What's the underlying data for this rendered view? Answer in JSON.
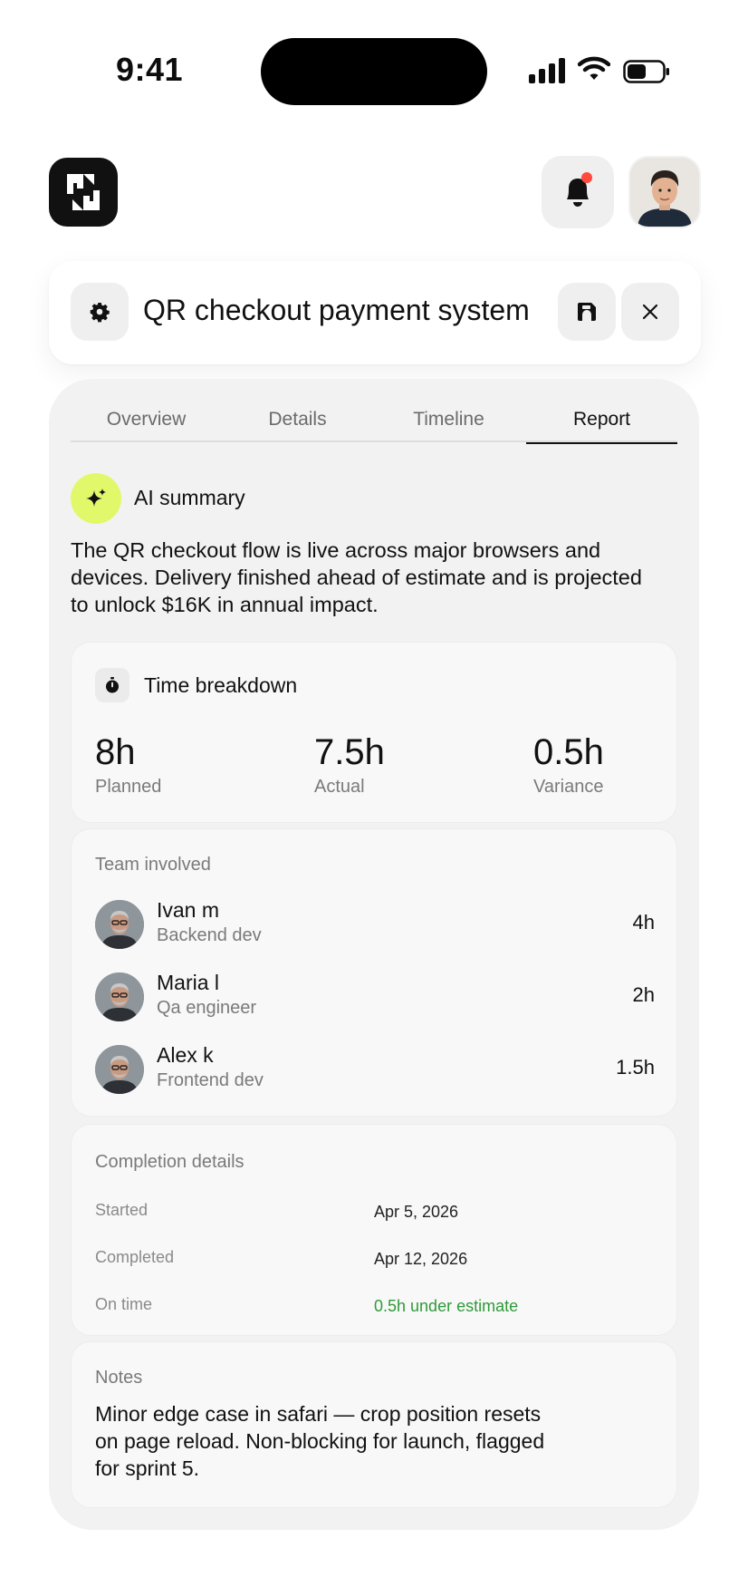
{
  "status_bar": {
    "time": "9:41"
  },
  "header": {
    "logo_icon": "app-logo-icon",
    "notification_dot_color": "#ff4a3d"
  },
  "title_bar": {
    "title": "QR checkout payment system"
  },
  "tabs": [
    {
      "label": "Overview"
    },
    {
      "label": "Details"
    },
    {
      "label": "Timeline"
    },
    {
      "label": "Report",
      "active": true
    }
  ],
  "ai_summary": {
    "label": "AI summary",
    "accent_color": "#e2f86b",
    "text": "The QR checkout flow is live across major browsers and devices. Delivery finished ahead of estimate and is projected to unlock $16K in annual impact."
  },
  "time_breakdown": {
    "label": "Time breakdown",
    "metrics": [
      {
        "value": "8h",
        "label": "Planned"
      },
      {
        "value": "7.5h",
        "label": "Actual"
      },
      {
        "value": "0.5h",
        "label": "Variance"
      }
    ]
  },
  "team": {
    "label": "Team involved",
    "members": [
      {
        "name": "Ivan m",
        "role": "Backend dev",
        "hours": "4h"
      },
      {
        "name": "Maria l",
        "role": "Qa engineer",
        "hours": "2h"
      },
      {
        "name": "Alex k",
        "role": "Frontend dev",
        "hours": "1.5h"
      }
    ]
  },
  "completion": {
    "label": "Completion details",
    "rows": [
      {
        "key": "Started",
        "value": "Apr 5, 2026"
      },
      {
        "key": "Completed",
        "value": "Apr 12, 2026"
      },
      {
        "key": "On time",
        "value": "0.5h under estimate",
        "color": "#2f9a3a"
      }
    ]
  },
  "notes": {
    "label": "Notes",
    "text": "Minor edge case in safari — crop position resets on page reload. Non-blocking for launch, flagged for sprint 5."
  }
}
